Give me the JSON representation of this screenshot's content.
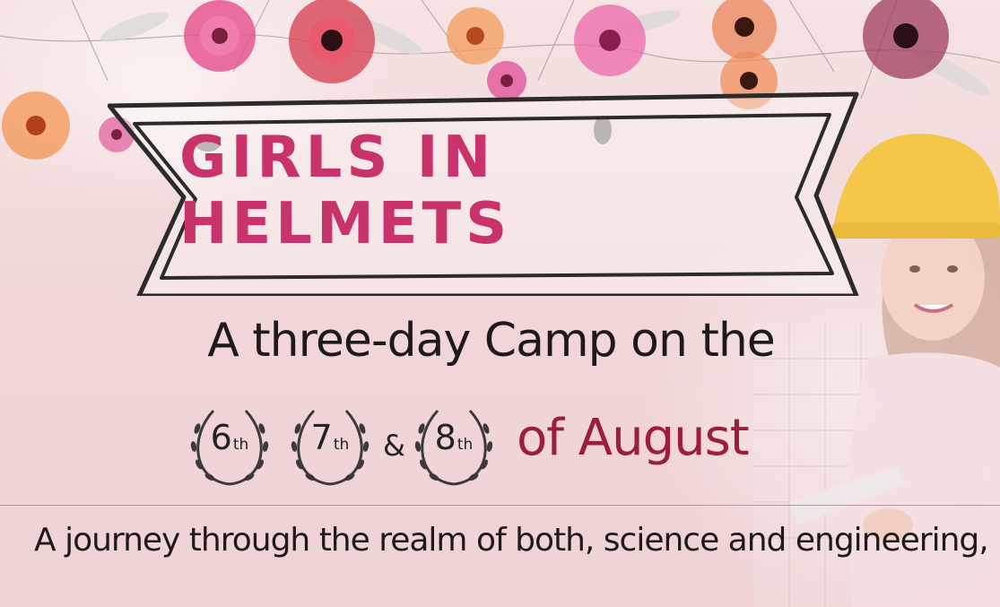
{
  "banner": {
    "title": "GIRLS IN HELMETS"
  },
  "subtitle": "A three-day Camp on the",
  "dates": [
    {
      "day": "6",
      "suffix": "th"
    },
    {
      "day": "7",
      "suffix": "th"
    },
    {
      "day": "8",
      "suffix": "th"
    }
  ],
  "ampersand": "&",
  "month_text": "of August",
  "tagline": "A journey through the realm of both, science and engineering,",
  "colors": {
    "title": "#c8336b",
    "month": "#9b1f3a",
    "text": "#1f1a1a",
    "background": "#f2d7d8",
    "helmet": "#f4c430"
  }
}
